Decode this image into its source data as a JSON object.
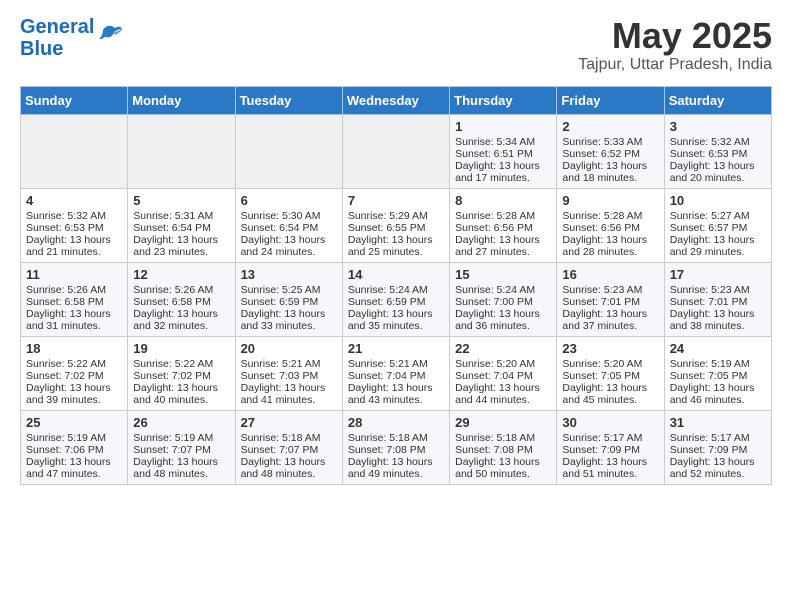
{
  "header": {
    "logo_line1": "General",
    "logo_line2": "Blue",
    "title": "May 2025",
    "subtitle": "Tajpur, Uttar Pradesh, India"
  },
  "days_of_week": [
    "Sunday",
    "Monday",
    "Tuesday",
    "Wednesday",
    "Thursday",
    "Friday",
    "Saturday"
  ],
  "weeks": [
    [
      {
        "day": "",
        "lines": []
      },
      {
        "day": "",
        "lines": []
      },
      {
        "day": "",
        "lines": []
      },
      {
        "day": "",
        "lines": []
      },
      {
        "day": "1",
        "lines": [
          "Sunrise: 5:34 AM",
          "Sunset: 6:51 PM",
          "Daylight: 13 hours",
          "and 17 minutes."
        ]
      },
      {
        "day": "2",
        "lines": [
          "Sunrise: 5:33 AM",
          "Sunset: 6:52 PM",
          "Daylight: 13 hours",
          "and 18 minutes."
        ]
      },
      {
        "day": "3",
        "lines": [
          "Sunrise: 5:32 AM",
          "Sunset: 6:53 PM",
          "Daylight: 13 hours",
          "and 20 minutes."
        ]
      }
    ],
    [
      {
        "day": "4",
        "lines": [
          "Sunrise: 5:32 AM",
          "Sunset: 6:53 PM",
          "Daylight: 13 hours",
          "and 21 minutes."
        ]
      },
      {
        "day": "5",
        "lines": [
          "Sunrise: 5:31 AM",
          "Sunset: 6:54 PM",
          "Daylight: 13 hours",
          "and 23 minutes."
        ]
      },
      {
        "day": "6",
        "lines": [
          "Sunrise: 5:30 AM",
          "Sunset: 6:54 PM",
          "Daylight: 13 hours",
          "and 24 minutes."
        ]
      },
      {
        "day": "7",
        "lines": [
          "Sunrise: 5:29 AM",
          "Sunset: 6:55 PM",
          "Daylight: 13 hours",
          "and 25 minutes."
        ]
      },
      {
        "day": "8",
        "lines": [
          "Sunrise: 5:28 AM",
          "Sunset: 6:56 PM",
          "Daylight: 13 hours",
          "and 27 minutes."
        ]
      },
      {
        "day": "9",
        "lines": [
          "Sunrise: 5:28 AM",
          "Sunset: 6:56 PM",
          "Daylight: 13 hours",
          "and 28 minutes."
        ]
      },
      {
        "day": "10",
        "lines": [
          "Sunrise: 5:27 AM",
          "Sunset: 6:57 PM",
          "Daylight: 13 hours",
          "and 29 minutes."
        ]
      }
    ],
    [
      {
        "day": "11",
        "lines": [
          "Sunrise: 5:26 AM",
          "Sunset: 6:58 PM",
          "Daylight: 13 hours",
          "and 31 minutes."
        ]
      },
      {
        "day": "12",
        "lines": [
          "Sunrise: 5:26 AM",
          "Sunset: 6:58 PM",
          "Daylight: 13 hours",
          "and 32 minutes."
        ]
      },
      {
        "day": "13",
        "lines": [
          "Sunrise: 5:25 AM",
          "Sunset: 6:59 PM",
          "Daylight: 13 hours",
          "and 33 minutes."
        ]
      },
      {
        "day": "14",
        "lines": [
          "Sunrise: 5:24 AM",
          "Sunset: 6:59 PM",
          "Daylight: 13 hours",
          "and 35 minutes."
        ]
      },
      {
        "day": "15",
        "lines": [
          "Sunrise: 5:24 AM",
          "Sunset: 7:00 PM",
          "Daylight: 13 hours",
          "and 36 minutes."
        ]
      },
      {
        "day": "16",
        "lines": [
          "Sunrise: 5:23 AM",
          "Sunset: 7:01 PM",
          "Daylight: 13 hours",
          "and 37 minutes."
        ]
      },
      {
        "day": "17",
        "lines": [
          "Sunrise: 5:23 AM",
          "Sunset: 7:01 PM",
          "Daylight: 13 hours",
          "and 38 minutes."
        ]
      }
    ],
    [
      {
        "day": "18",
        "lines": [
          "Sunrise: 5:22 AM",
          "Sunset: 7:02 PM",
          "Daylight: 13 hours",
          "and 39 minutes."
        ]
      },
      {
        "day": "19",
        "lines": [
          "Sunrise: 5:22 AM",
          "Sunset: 7:02 PM",
          "Daylight: 13 hours",
          "and 40 minutes."
        ]
      },
      {
        "day": "20",
        "lines": [
          "Sunrise: 5:21 AM",
          "Sunset: 7:03 PM",
          "Daylight: 13 hours",
          "and 41 minutes."
        ]
      },
      {
        "day": "21",
        "lines": [
          "Sunrise: 5:21 AM",
          "Sunset: 7:04 PM",
          "Daylight: 13 hours",
          "and 43 minutes."
        ]
      },
      {
        "day": "22",
        "lines": [
          "Sunrise: 5:20 AM",
          "Sunset: 7:04 PM",
          "Daylight: 13 hours",
          "and 44 minutes."
        ]
      },
      {
        "day": "23",
        "lines": [
          "Sunrise: 5:20 AM",
          "Sunset: 7:05 PM",
          "Daylight: 13 hours",
          "and 45 minutes."
        ]
      },
      {
        "day": "24",
        "lines": [
          "Sunrise: 5:19 AM",
          "Sunset: 7:05 PM",
          "Daylight: 13 hours",
          "and 46 minutes."
        ]
      }
    ],
    [
      {
        "day": "25",
        "lines": [
          "Sunrise: 5:19 AM",
          "Sunset: 7:06 PM",
          "Daylight: 13 hours",
          "and 47 minutes."
        ]
      },
      {
        "day": "26",
        "lines": [
          "Sunrise: 5:19 AM",
          "Sunset: 7:07 PM",
          "Daylight: 13 hours",
          "and 48 minutes."
        ]
      },
      {
        "day": "27",
        "lines": [
          "Sunrise: 5:18 AM",
          "Sunset: 7:07 PM",
          "Daylight: 13 hours",
          "and 48 minutes."
        ]
      },
      {
        "day": "28",
        "lines": [
          "Sunrise: 5:18 AM",
          "Sunset: 7:08 PM",
          "Daylight: 13 hours",
          "and 49 minutes."
        ]
      },
      {
        "day": "29",
        "lines": [
          "Sunrise: 5:18 AM",
          "Sunset: 7:08 PM",
          "Daylight: 13 hours",
          "and 50 minutes."
        ]
      },
      {
        "day": "30",
        "lines": [
          "Sunrise: 5:17 AM",
          "Sunset: 7:09 PM",
          "Daylight: 13 hours",
          "and 51 minutes."
        ]
      },
      {
        "day": "31",
        "lines": [
          "Sunrise: 5:17 AM",
          "Sunset: 7:09 PM",
          "Daylight: 13 hours",
          "and 52 minutes."
        ]
      }
    ]
  ]
}
